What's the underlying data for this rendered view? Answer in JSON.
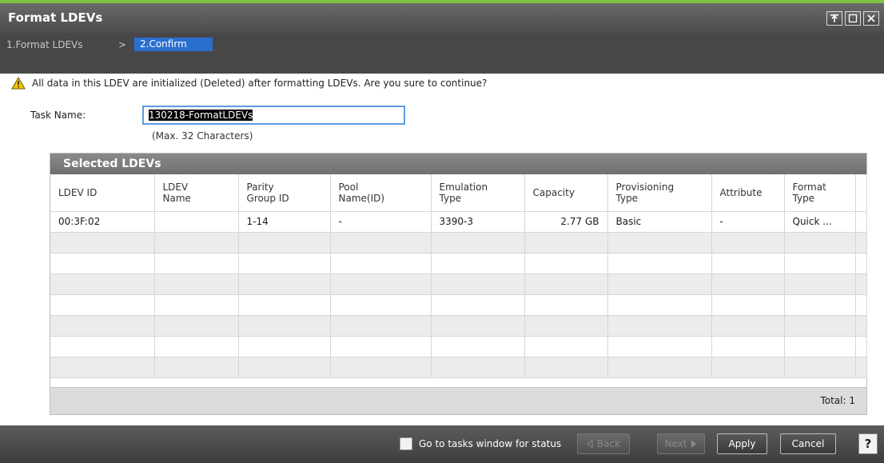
{
  "window": {
    "title": "Format LDEVs",
    "controls": [
      {
        "name": "restore-icon",
        "glyph": "⤒"
      },
      {
        "name": "maximize-icon",
        "glyph": "☐"
      },
      {
        "name": "close-icon",
        "glyph": "✕"
      }
    ]
  },
  "steps": {
    "step1": "1.Format LDEVs",
    "separator": ">",
    "step2": "2.Confirm"
  },
  "warning": {
    "icon": "warning-icon",
    "text": "All data in this LDEV are initialized (Deleted) after formatting LDEVs. Are you sure to continue?"
  },
  "task_name": {
    "label": "Task Name:",
    "value": "130218-FormatLDEVs",
    "note": "(Max. 32 Characters)"
  },
  "selected_ldevs": {
    "title": "Selected LDEVs",
    "columns": [
      [
        "LDEV ID"
      ],
      [
        "LDEV",
        "Name"
      ],
      [
        "Parity",
        "Group ID"
      ],
      [
        "Pool",
        "Name(ID)"
      ],
      [
        "Emulation",
        "Type"
      ],
      [
        "Capacity"
      ],
      [
        "Provisioning",
        "Type"
      ],
      [
        "Attribute"
      ],
      [
        "Format",
        "Type"
      ]
    ],
    "rows": [
      [
        "00:3F:02",
        "",
        "1-14",
        "-",
        "3390-3",
        "2.77 GB",
        "Basic",
        "-",
        "Quick ..."
      ]
    ],
    "total_label": "Total:",
    "total_value": "1"
  },
  "footer": {
    "goto_label": "Go to tasks window for status",
    "back_label": "Back",
    "next_label": "Next",
    "apply_label": "Apply",
    "cancel_label": "Cancel",
    "help_label": "?"
  },
  "colors": {
    "accent_green": "#7ec242",
    "active_step": "#2a6fd0",
    "focus_border": "#5b9be0"
  }
}
